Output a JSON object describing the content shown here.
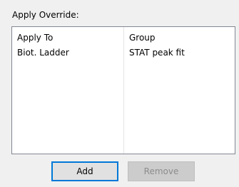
{
  "override": {
    "label": "Apply Override:",
    "columns": [
      "Apply To",
      "Group"
    ],
    "rows": [
      [
        "Biot. Ladder",
        "STAT peak fit"
      ]
    ],
    "add_label": "Add",
    "remove_label": "Remove",
    "remove_enabled": false
  },
  "colors": {
    "background": "#f0f0f0",
    "focus_border": "#0078d7",
    "disabled_text": "#8c8c8c"
  }
}
